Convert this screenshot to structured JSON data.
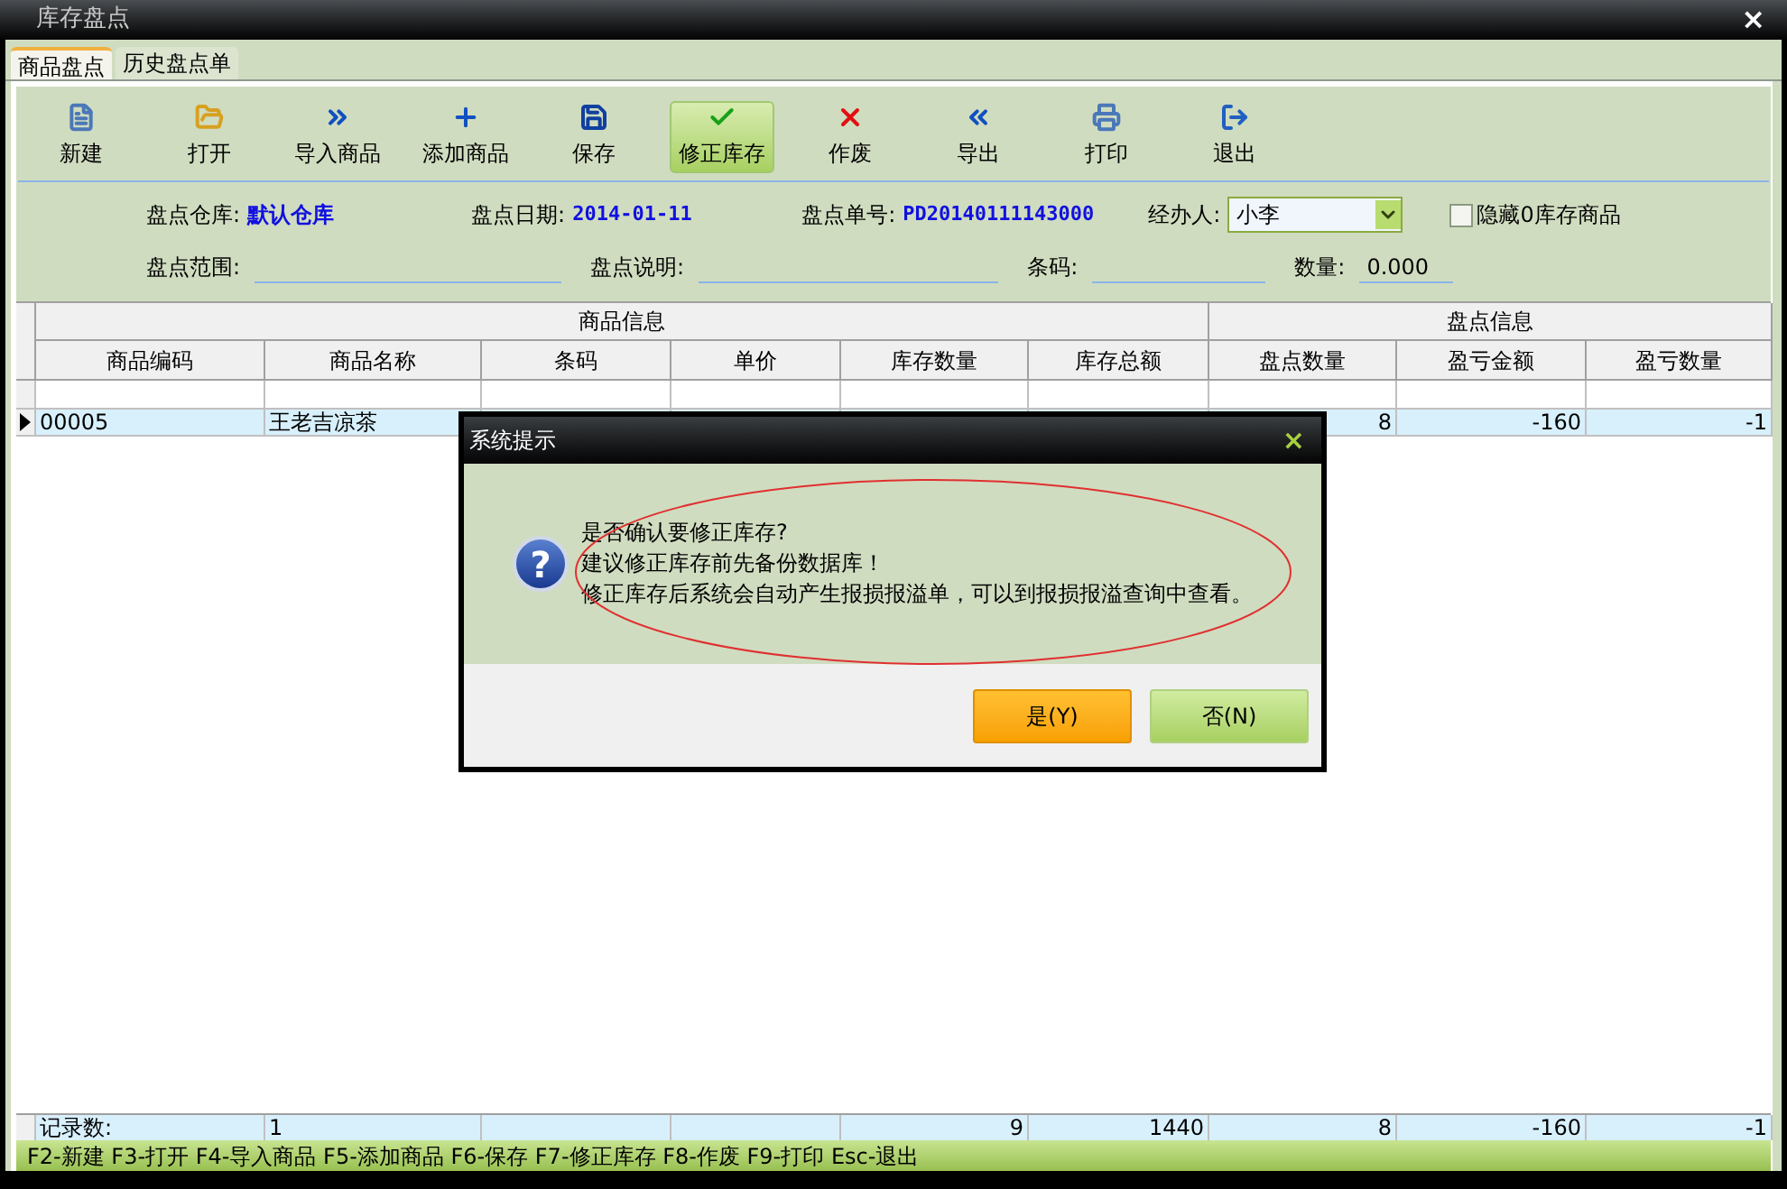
{
  "window": {
    "title": "库存盘点",
    "close": "×"
  },
  "tabs": [
    {
      "label": "商品盘点",
      "selected": true
    },
    {
      "label": "历史盘点单",
      "selected": false
    }
  ],
  "toolbar": [
    {
      "label": "新建",
      "kind": "file",
      "selected": false
    },
    {
      "label": "打开",
      "kind": "folder",
      "selected": false
    },
    {
      "label": "导入商品",
      "kind": "import",
      "selected": false
    },
    {
      "label": "添加商品",
      "kind": "plus",
      "selected": false
    },
    {
      "label": "保存",
      "kind": "save",
      "selected": false
    },
    {
      "label": "修正库存",
      "kind": "check",
      "selected": true
    },
    {
      "label": "作废",
      "kind": "cancel",
      "selected": false
    },
    {
      "label": "导出",
      "kind": "export",
      "selected": false
    },
    {
      "label": "打印",
      "kind": "print",
      "selected": false
    },
    {
      "label": "退出",
      "kind": "exit",
      "selected": false
    }
  ],
  "form": {
    "warehouse": {
      "label": "盘点仓库:",
      "value": "默认仓库"
    },
    "date": {
      "label": "盘点日期:",
      "value": "2014-01-11"
    },
    "order_no": {
      "label": "盘点单号:",
      "value": "PD20140111143000"
    },
    "handler": {
      "label": "经办人:",
      "value": "小李"
    },
    "hide_zero": {
      "label": "隐藏0库存商品",
      "checked": false
    },
    "range": {
      "label": "盘点范围:"
    },
    "note": {
      "label": "盘点说明:"
    },
    "barcode": {
      "label": "条码:"
    },
    "quantity": {
      "label": "数量:",
      "value": "0.000"
    }
  },
  "table": {
    "groups": [
      {
        "label": "商品信息",
        "columns": [
          {
            "label": "商品编码",
            "kind": "text"
          },
          {
            "label": "商品名称",
            "kind": "text"
          },
          {
            "label": "条码",
            "kind": "text"
          },
          {
            "label": "单价",
            "kind": "number"
          },
          {
            "label": "库存数量",
            "kind": "number"
          },
          {
            "label": "库存总额",
            "kind": "number"
          }
        ]
      },
      {
        "label": "盘点信息",
        "columns": [
          {
            "label": "盘点数量",
            "kind": "number"
          },
          {
            "label": "盈亏金额",
            "kind": "number"
          },
          {
            "label": "盈亏数量",
            "kind": "number"
          }
        ]
      }
    ],
    "rows": [
      {
        "selected": true,
        "cells": [
          "00005",
          "王老吉凉茶",
          null,
          null,
          null,
          null,
          "8",
          "-160",
          "-1"
        ]
      }
    ],
    "footer": {
      "label": "记录数:",
      "count": "1",
      "totals": [
        "9",
        "1440",
        "8",
        "-160",
        "-1"
      ]
    }
  },
  "status_bar": "F2-新建 F3-打开 F4-导入商品 F5-添加商品 F6-保存 F7-修正库存 F8-作废 F9-打印 Esc-退出",
  "dialog": {
    "title": "系统提示",
    "close": "×",
    "glyph": "?",
    "lines": [
      "是否确认要修正库存?",
      "建议修正库存前先备份数据库！",
      "修正库存后系统会自动产生报损报溢单，可以到报损报溢查询中查看。"
    ],
    "buttons": [
      {
        "label": "是(Y)",
        "kind": "primary"
      },
      {
        "label": "否(N)",
        "kind": "secondary"
      }
    ]
  }
}
